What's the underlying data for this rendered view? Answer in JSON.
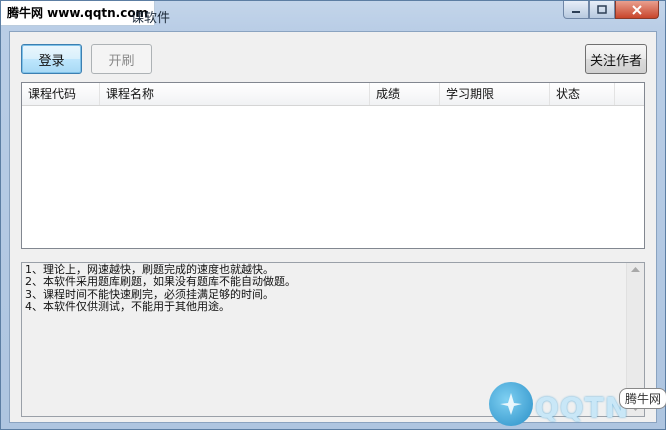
{
  "window": {
    "title": "课软件",
    "watermark_top": "腾牛网 www.qqtn.com"
  },
  "toolbar": {
    "login_label": "登录",
    "start_label": "开刷",
    "follow_label": "关注作者"
  },
  "list": {
    "columns": [
      "课程代码",
      "课程名称",
      "成绩",
      "学习期限",
      "状态"
    ]
  },
  "notes": [
    "1、理论上，网速越快，刷题完成的速度也就越快。",
    "2、本软件采用题库刷题，如果没有题库不能自动做题。",
    "3、课程时间不能快速刷完，必须挂满足够的时间。",
    "4、本软件仅供测试，不能用于其他用途。"
  ],
  "watermark_bottom": {
    "brand": "QQTN",
    "badge": "腾牛网"
  },
  "icons": {
    "minimize": "minimize-icon",
    "maximize": "maximize-icon",
    "close": "close-icon",
    "scroll_up": "scroll-up-icon",
    "scroll_down": "scroll-down-icon"
  }
}
